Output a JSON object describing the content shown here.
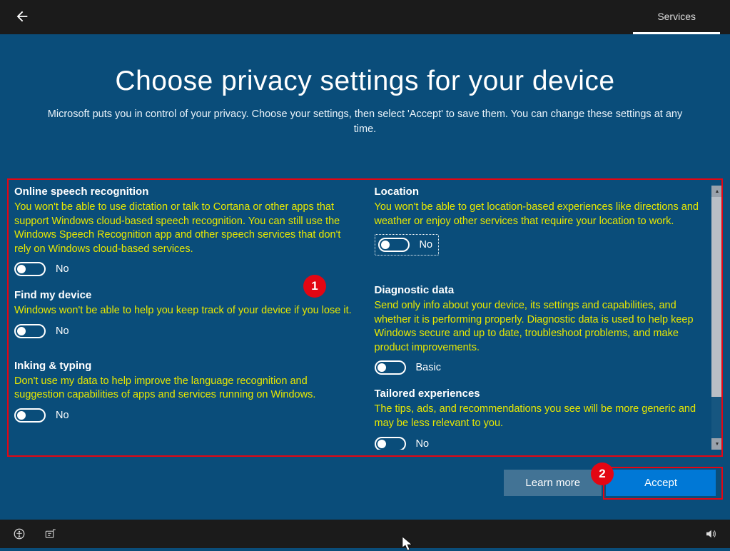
{
  "header": {
    "tab_label": "Services"
  },
  "page": {
    "title": "Choose privacy settings for your device",
    "subtitle": "Microsoft puts you in control of your privacy. Choose your settings, then select 'Accept' to save them. You can change these settings at any time."
  },
  "settings": {
    "left": [
      {
        "title": "Online speech recognition",
        "desc": "You won't be able to use dictation or talk to Cortana or other apps that support Windows cloud-based speech recognition. You can still use the Windows Speech Recognition app and other speech services that don't rely on Windows cloud-based services.",
        "value_label": "No"
      },
      {
        "title": "Find my device",
        "desc": "Windows won't be able to help you keep track of your device if you lose it.",
        "value_label": "No"
      },
      {
        "title": "Inking & typing",
        "desc": "Don't use my data to help improve the language recognition and suggestion capabilities of apps and services running on Windows.",
        "value_label": "No"
      }
    ],
    "right": [
      {
        "title": "Location",
        "desc": "You won't be able to get location-based experiences like directions and weather or enjoy other services that require your location to work.",
        "value_label": "No"
      },
      {
        "title": "Diagnostic data",
        "desc": "Send only info about your device, its settings and capabilities, and whether it is performing properly. Diagnostic data is used to help keep Windows secure and up to date, troubleshoot problems, and make product improvements.",
        "value_label": "Basic"
      },
      {
        "title": "Tailored experiences",
        "desc": "The tips, ads, and recommendations you see will be more generic and may be less relevant to you.",
        "value_label": "No"
      }
    ]
  },
  "buttons": {
    "learn_more": "Learn more",
    "accept": "Accept"
  },
  "annotations": {
    "badge1": "1",
    "badge2": "2"
  }
}
